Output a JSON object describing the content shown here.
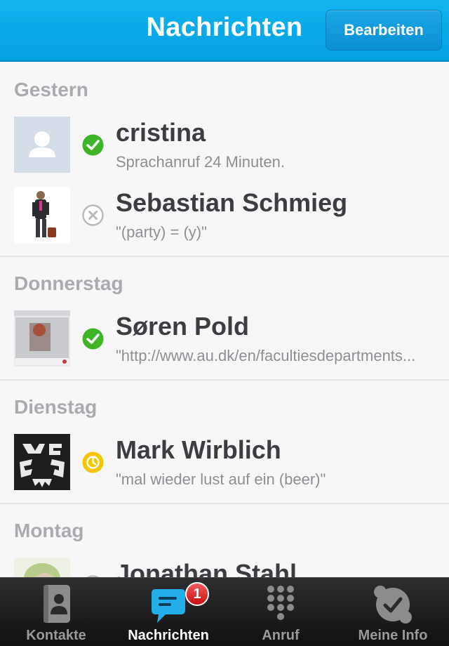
{
  "header": {
    "title": "Nachrichten",
    "edit_label": "Bearbeiten"
  },
  "sections": [
    {
      "label": "Gestern"
    },
    {
      "label": "Donnerstag"
    },
    {
      "label": "Dienstag"
    },
    {
      "label": "Montag"
    }
  ],
  "conversations": [
    {
      "name": "cristina",
      "subtitle": "Sprachanruf  24 Minuten.",
      "status": "online",
      "avatar": "default-avatar"
    },
    {
      "name": "Sebastian Schmieg",
      "subtitle": "\"(party) = (y)\"",
      "status": "offline",
      "avatar": "person-photo"
    },
    {
      "name": "Søren Pold",
      "subtitle": "\"http://www.au.dk/en/facultiesdepartments...",
      "status": "online",
      "avatar": "screenshot-photo"
    },
    {
      "name": "Mark Wirblich",
      "subtitle": "\"mal wieder lust auf ein  (beer)\"",
      "status": "away",
      "avatar": "logo-image"
    },
    {
      "name": "Jonathan Stahl",
      "subtitle": "",
      "status": "offline",
      "avatar": "person-photo-2"
    }
  ],
  "tabbar": {
    "tabs": [
      {
        "label": "Kontakte",
        "icon": "contacts-icon"
      },
      {
        "label": "Nachrichten",
        "icon": "chat-bubble-icon",
        "badge": "1",
        "active": true
      },
      {
        "label": "Anruf",
        "icon": "dialpad-icon"
      },
      {
        "label": "Meine Info",
        "icon": "skype-check-icon"
      }
    ]
  },
  "colors": {
    "header": "#04a0e2",
    "online": "#3fb427",
    "away": "#f5c500",
    "badge": "#d01b1b"
  }
}
